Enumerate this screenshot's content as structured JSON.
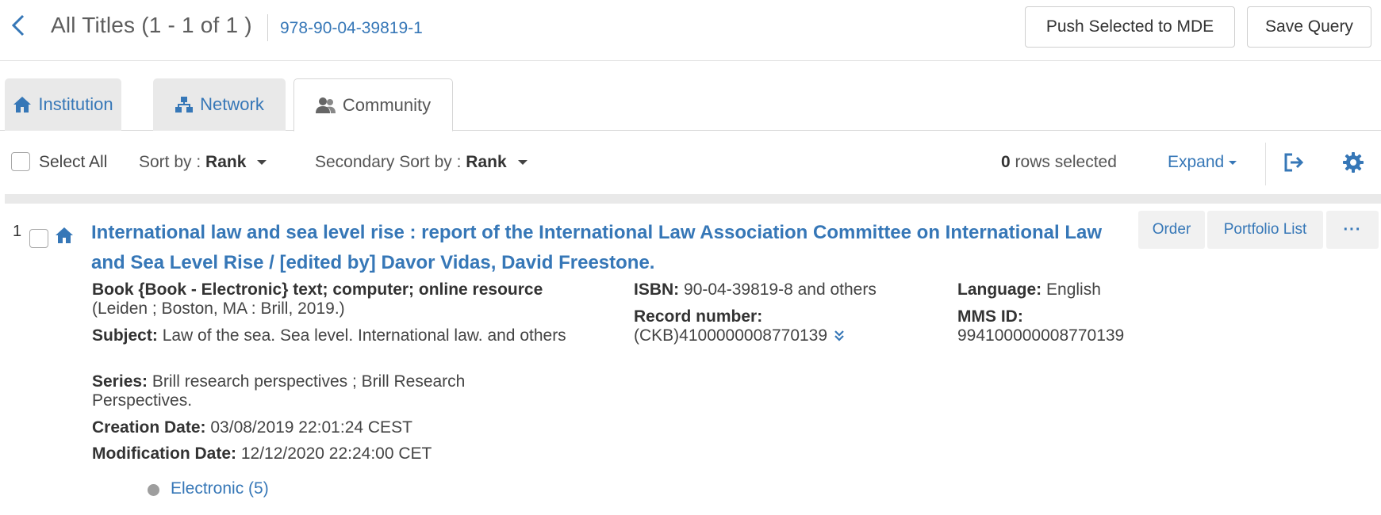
{
  "header": {
    "title": "All Titles (1 - 1 of 1 )",
    "search_term": "978-90-04-39819-1",
    "push_button": "Push Selected to MDE",
    "save_button": "Save Query"
  },
  "tabs": [
    {
      "label": "Institution",
      "icon": "home-icon"
    },
    {
      "label": "Network",
      "icon": "network-icon"
    },
    {
      "label": "Community",
      "icon": "users-icon",
      "active": true
    }
  ],
  "toolbar": {
    "select_all": "Select All",
    "sort_label": "Sort by :",
    "sort_value": "Rank",
    "secondary_sort_label": "Secondary Sort by :",
    "secondary_sort_value": "Rank",
    "rows_selected_count": "0",
    "rows_selected_text": "rows selected",
    "expand": "Expand"
  },
  "results": [
    {
      "index": "1",
      "title_line1": "International law and sea level rise : report of the International Law Association Committee on International Law",
      "title_line2": "and Sea Level Rise / [edited by] Davor Vidas, David Freestone.",
      "actions": {
        "order": "Order",
        "portfolio": "Portfolio List",
        "more": "···"
      },
      "type": "Book {Book - Electronic} text; computer; online resource",
      "publication": "(Leiden ; Boston, MA : Brill, 2019.)",
      "subject_label": "Subject:",
      "subject_value": "Law of the sea. Sea level. International law. and others",
      "series_label": "Series:",
      "series_value": "Brill research perspectives ; Brill Research Perspectives.",
      "creation_label": "Creation Date:",
      "creation_value": "03/08/2019 22:01:24 CEST",
      "modification_label": "Modification Date:",
      "modification_value": "12/12/2020 22:24:00 CET",
      "isbn_label": "ISBN:",
      "isbn_value": "90-04-39819-8 and others",
      "record_label": "Record number:",
      "record_value": "(CKB)4100000008770139",
      "language_label": "Language:",
      "language_value": "English",
      "mms_label": "MMS ID:",
      "mms_value": "994100000008770139",
      "inventory": "Electronic (5)"
    }
  ],
  "colors": {
    "link": "#3677b7",
    "tab_inactive": "#e9e9e9",
    "text": "#333333"
  }
}
